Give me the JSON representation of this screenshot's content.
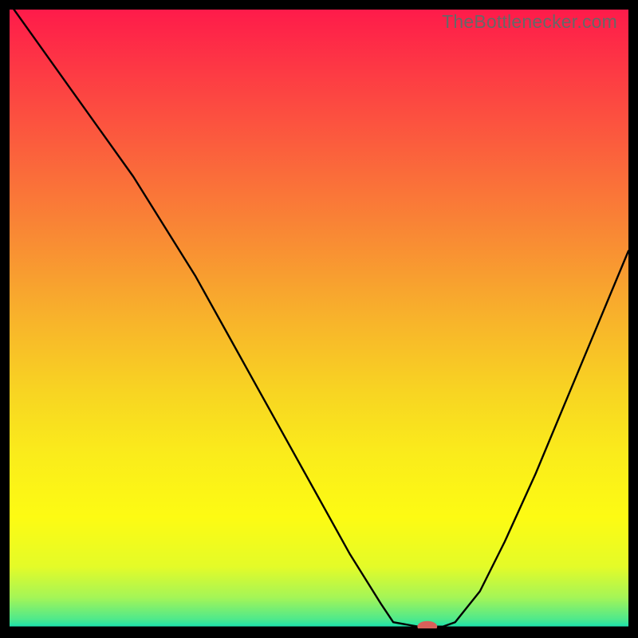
{
  "watermark": "TheBottlenecker.com",
  "colors": {
    "curve": "#000000",
    "marker_fill": "#d9605a",
    "gradient_stops": [
      {
        "offset": 0.0,
        "color": "#fe1b4a"
      },
      {
        "offset": 0.1,
        "color": "#fd3a44"
      },
      {
        "offset": 0.22,
        "color": "#fb5e3d"
      },
      {
        "offset": 0.35,
        "color": "#f98535"
      },
      {
        "offset": 0.5,
        "color": "#f8b32b"
      },
      {
        "offset": 0.62,
        "color": "#f8d522"
      },
      {
        "offset": 0.72,
        "color": "#faec1b"
      },
      {
        "offset": 0.82,
        "color": "#fdfb13"
      },
      {
        "offset": 0.9,
        "color": "#e4fb28"
      },
      {
        "offset": 0.95,
        "color": "#a4f557"
      },
      {
        "offset": 0.985,
        "color": "#4fe98b"
      },
      {
        "offset": 1.0,
        "color": "#0fe0b6"
      }
    ]
  },
  "chart_data": {
    "type": "line",
    "title": "",
    "xlabel": "",
    "ylabel": "",
    "xlim": [
      0,
      100
    ],
    "ylim": [
      0,
      100
    ],
    "series": [
      {
        "name": "bottleneck-curve",
        "x": [
          0,
          5,
          10,
          15,
          20,
          25,
          30,
          35,
          40,
          45,
          50,
          55,
          60,
          62,
          66,
          70,
          72,
          76,
          80,
          85,
          90,
          95,
          100
        ],
        "y": [
          101,
          94,
          87,
          80,
          73,
          65,
          57,
          48,
          39,
          30,
          21,
          12,
          4,
          1,
          0.3,
          0.3,
          1,
          6,
          14,
          25,
          37,
          49,
          61
        ]
      }
    ],
    "marker": {
      "x": 67.5,
      "y": 0.3,
      "rx": 1.6,
      "ry": 0.9
    },
    "annotations": []
  }
}
